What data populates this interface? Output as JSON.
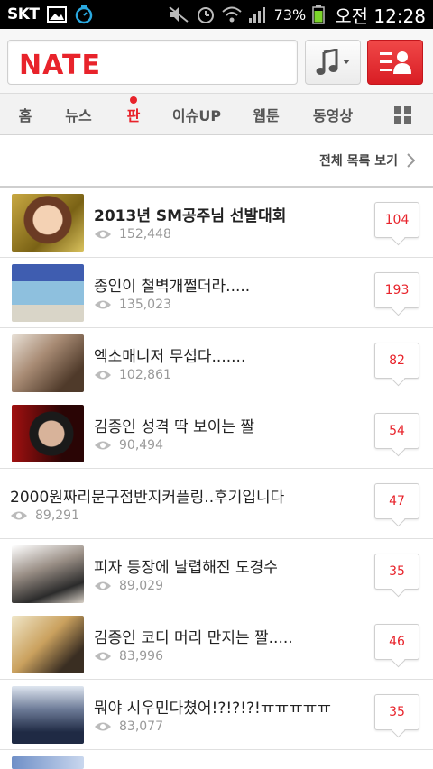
{
  "status_bar": {
    "carrier": "SKT",
    "battery_pct": "73%",
    "time": "오전 12:28"
  },
  "header": {
    "logo": "NATE",
    "search": {
      "value": "",
      "placeholder": ""
    }
  },
  "tabs": [
    {
      "label": "홈",
      "active": false
    },
    {
      "label": "뉴스",
      "active": false
    },
    {
      "label": "판",
      "active": true
    },
    {
      "label": "이슈UP",
      "active": false
    },
    {
      "label": "웹툰",
      "active": false
    },
    {
      "label": "동영상",
      "active": false
    }
  ],
  "list_header": {
    "view_all": "전체 목록 보기"
  },
  "items": [
    {
      "title": "2013년 SM공주님 선발대회",
      "views": "152,448",
      "comments": "104",
      "has_thumb": true,
      "bold": true
    },
    {
      "title": "종인이 철벽개쩔더라.....",
      "views": "135,023",
      "comments": "193",
      "has_thumb": true,
      "bold": false
    },
    {
      "title": "엑소매니저 무섭다.......",
      "views": "102,861",
      "comments": "82",
      "has_thumb": true,
      "bold": false
    },
    {
      "title": "김종인 성격 딱 보이는 짤",
      "views": "90,494",
      "comments": "54",
      "has_thumb": true,
      "bold": false
    },
    {
      "title": "2000원짜리문구점반지커플링..후기입니다",
      "views": "89,291",
      "comments": "47",
      "has_thumb": false,
      "bold": false
    },
    {
      "title": "피자 등장에 날렵해진 도경수",
      "views": "89,029",
      "comments": "35",
      "has_thumb": true,
      "bold": false
    },
    {
      "title": "김종인 코디 머리 만지는 짤.....",
      "views": "83,996",
      "comments": "46",
      "has_thumb": true,
      "bold": false
    },
    {
      "title": "뭐야 시우민다쳤어!?!?!?!ㅠㅠㅠㅠㅠ",
      "views": "83,077",
      "comments": "35",
      "has_thumb": true,
      "bold": false
    }
  ],
  "colors": {
    "brand_red": "#e8232b",
    "tab_bg": "#f2f2f2",
    "views_gray": "#999999"
  }
}
